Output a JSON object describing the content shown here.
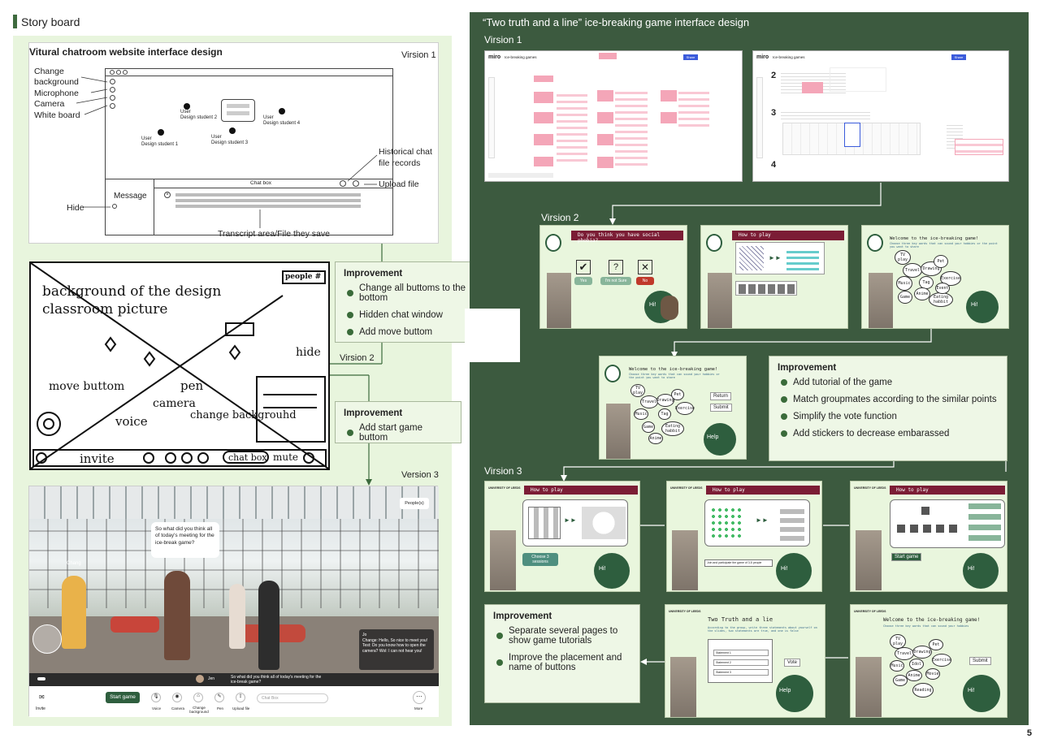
{
  "header": {
    "title": "Story board"
  },
  "left": {
    "panel1_title": "Vitural chatroom website interface design",
    "version1": "Virsion 1",
    "labels": {
      "change_bg": "Change\nbackground",
      "microphone": "Microphone",
      "camera": "Camera",
      "white_board": "White board",
      "hide": "Hide",
      "message": "Message",
      "chat_box": "Chat box",
      "history": "Historical chat\nfile records",
      "upload": "Upload file",
      "transcript": "Transcript area/File they save"
    },
    "users": [
      "User\nDesign student 1",
      "User\nDesign student 2",
      "User\nDesign student 3",
      "User\nDesign student 4"
    ],
    "sketch": {
      "bg_text": "background of the design classroom picture",
      "people": "people #",
      "hide": "hide",
      "move": "move buttom",
      "pen": "pen",
      "camera": "camera",
      "change_bg": "change backgrouhd",
      "voice": "voice",
      "invite": "invite",
      "chat": "chat box",
      "mute": "mute"
    },
    "improvement1": {
      "title": "Improvement",
      "items": [
        "Change all buttoms to the bottom",
        "Hidden chat window",
        "Add move buttom"
      ]
    },
    "version2": "Virsion 2",
    "improvement2": {
      "title": "Improvement",
      "items": [
        "Add start game buttom"
      ]
    },
    "version3": "Version 3",
    "v3": {
      "speech": "So what did you think all of today's meeting for the ice-break game?",
      "people": "People(s)",
      "chat_name": "Jo",
      "chat_msg": "Change: Hello, So nice to meet you! Test: Do you know how to open the camera? Wol: I can not hear you!",
      "chat_line": "So what did you think all of today's meeting for the ice-break game?",
      "jen": "Jen",
      "start": "Start game",
      "buttons": [
        "Invite",
        "Voice",
        "Camera",
        "Change background",
        "Pen",
        "Upload file",
        "More"
      ],
      "chat_placeholder": "Chat Box",
      "chang": "Chang"
    }
  },
  "right": {
    "title": "“Two truth and a line” ice-breaking game interface  design",
    "version1": "Virsion 1",
    "miro": {
      "logo": "miro",
      "board": "Ice-breaking games",
      "share": "Share"
    },
    "version2": "Virsion 2",
    "v2a": {
      "q": "Do you think you have social phobia?",
      "yes": "Yes",
      "unsure": "I'm not Sure",
      "no": "No",
      "hi": "Hi!"
    },
    "v2b": {
      "title": "How to play"
    },
    "v2c": {
      "title": "Welcome to the ice-breaking game!",
      "sub": "Choose three key words that can sound your hobbies or the point you want to share",
      "words": [
        "TV play",
        "Travel",
        "Drawing",
        "Pet",
        "Music",
        "Tag",
        "Exercise",
        "Game",
        "Anime",
        "Eating habbit",
        "Event"
      ]
    },
    "v2d": {
      "title": "Welcome to the ice-breaking game!",
      "sub": "Choose three key words that can sound your hobbies or the point you want to share",
      "words": [
        "TV play",
        "Travel",
        "Drawing",
        "Pet",
        "Exercise",
        "Music",
        "Tag",
        "Game",
        "Eating habbit",
        "Anime"
      ],
      "return": "Return",
      "submit": "Submit",
      "help": "Help"
    },
    "improvement_v2": {
      "title": "Improvement",
      "items": [
        "Add tutorial of the game",
        "Match groupmates according to the similar points",
        "Simplify the vote function",
        "Add stickers to decrease embarassed"
      ]
    },
    "version3": "Virsion 3",
    "v3": {
      "uni": "UNIVERSITY OF LEEDS",
      "how": "How to play",
      "choose": "Choose 3 sessions",
      "join": "Join and participate the game of 3-5 people",
      "start": "Start game",
      "hi": "Hi!",
      "tt_title": "Two Truth and a lie",
      "tt_sub": "According to the group, write three statements about yourself on the slides, two statements are true, and one is false",
      "vote": "Vote",
      "welcome": "Welcome to the ice-breaking game!",
      "welcome_sub": "Choose three key words that can sound your hobbies",
      "submit": "Submit",
      "help": "Help",
      "words": [
        "TV play",
        "Travel",
        "Drawing",
        "Pet",
        "Music",
        "Idol",
        "Exercise",
        "Game",
        "Anime",
        "Movie",
        "Reading"
      ],
      "rows": [
        "Statement 1",
        "Statement 2",
        "Statement 3"
      ]
    },
    "improvement_v3": {
      "title": "Improvement",
      "items": [
        "Separate several pages to show game tutorials",
        "Improve the placement and name of buttons"
      ]
    }
  },
  "page_number": "5"
}
